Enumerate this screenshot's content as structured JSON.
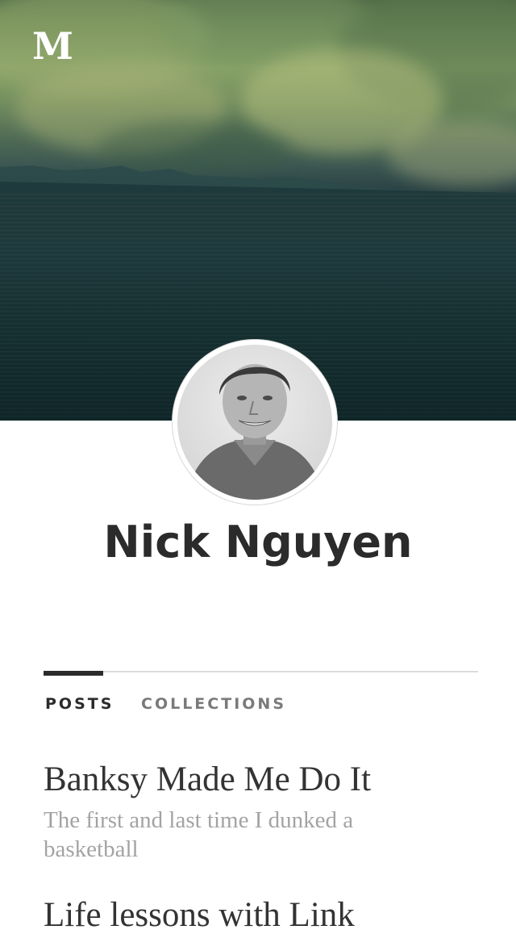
{
  "app": {
    "logo": "M"
  },
  "profile": {
    "name": "Nick Nguyen"
  },
  "tabs": [
    {
      "label": "POSTS",
      "active": true
    },
    {
      "label": "COLLECTIONS",
      "active": false
    }
  ],
  "posts": [
    {
      "title": "Banksy Made Me Do It",
      "subtitle": "The first and last time I dunked a basketball"
    },
    {
      "title": "Life lessons with Link",
      "subtitle": ""
    }
  ],
  "colors": {
    "text": "#2b2b2b",
    "muted": "#a3a3a3",
    "divider": "#dcdcdc"
  }
}
